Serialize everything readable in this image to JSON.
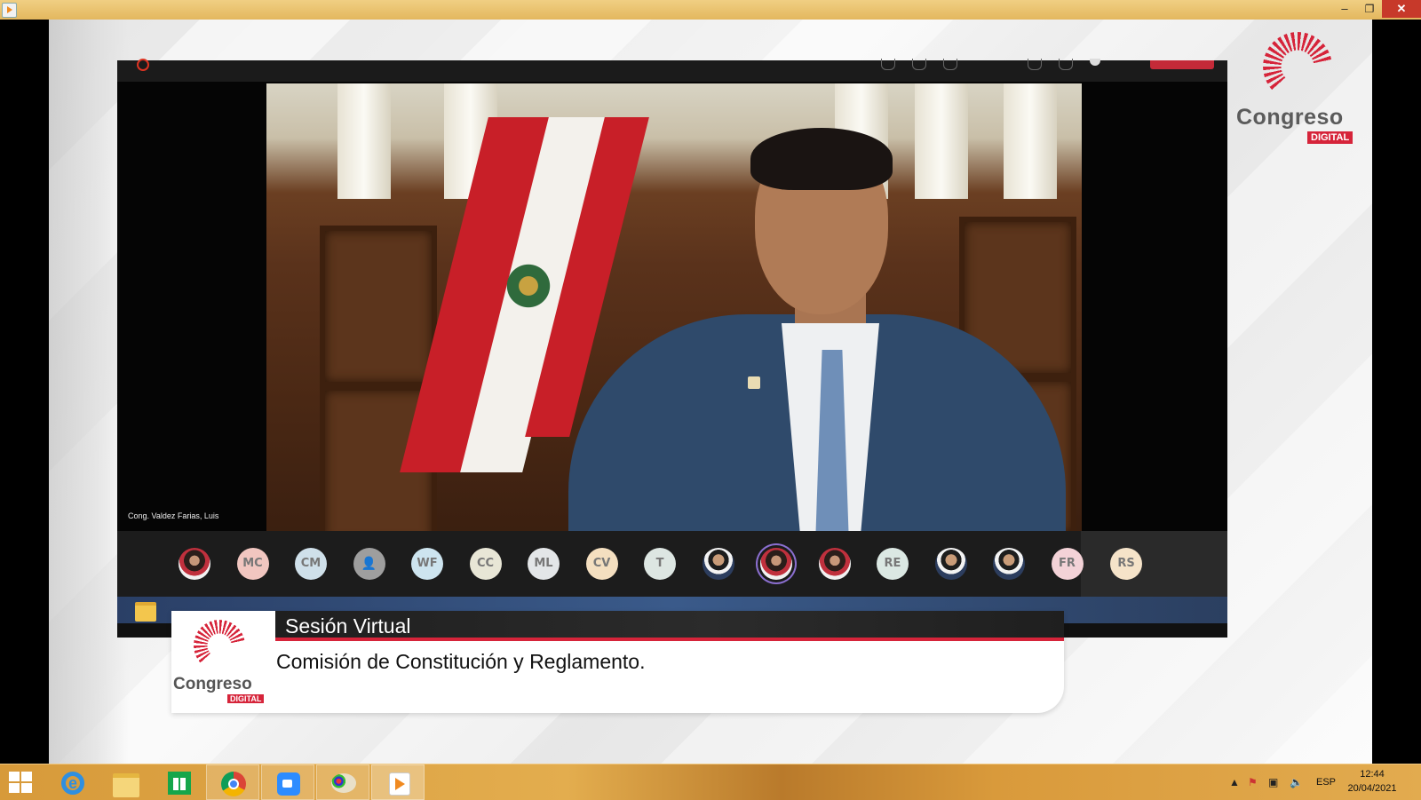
{
  "window": {
    "minimize_glyph": "–",
    "maximize_glyph": "❐",
    "close_glyph": "✕"
  },
  "brand": {
    "logo_word": "Congreso",
    "logo_badge": "DIGITAL",
    "accent_color": "#d6243a"
  },
  "meeting": {
    "speaker_name": "Cong. Valdez Farias, Luis",
    "participants": [
      {
        "initials": "",
        "kind": "photo-f",
        "color": ""
      },
      {
        "initials": "MC",
        "kind": "initials",
        "color": "#f1c6c0"
      },
      {
        "initials": "CM",
        "kind": "initials",
        "color": "#cfe0ea"
      },
      {
        "initials": "",
        "kind": "user",
        "color": "#9e9e9e"
      },
      {
        "initials": "WF",
        "kind": "initials",
        "color": "#cde4ef"
      },
      {
        "initials": "CC",
        "kind": "initials",
        "color": "#e8e6d6"
      },
      {
        "initials": "ML",
        "kind": "initials",
        "color": "#e3e6e8"
      },
      {
        "initials": "CV",
        "kind": "initials",
        "color": "#f4dfc0"
      },
      {
        "initials": "T",
        "kind": "initials",
        "color": "#dde6e2"
      },
      {
        "initials": "",
        "kind": "photo",
        "color": ""
      },
      {
        "initials": "",
        "kind": "photo-f",
        "color": "",
        "active": true
      },
      {
        "initials": "",
        "kind": "photo-f",
        "color": ""
      },
      {
        "initials": "RE",
        "kind": "initials",
        "color": "#dbe8e3"
      },
      {
        "initials": "",
        "kind": "photo",
        "color": ""
      },
      {
        "initials": "",
        "kind": "photo",
        "color": ""
      },
      {
        "initials": "FR",
        "kind": "initials",
        "color": "#f3d2d7"
      },
      {
        "initials": "RS",
        "kind": "initials",
        "color": "#f5e3c9"
      }
    ]
  },
  "lower_third": {
    "title": "Sesión Virtual",
    "subtitle": "Comisión de Constitución y Reglamento."
  },
  "taskbar": {
    "apps": [
      "start",
      "internet-explorer",
      "file-explorer",
      "store",
      "chrome",
      "zoom",
      "paint",
      "media-player"
    ],
    "running": [
      "chrome",
      "zoom",
      "paint",
      "media-player"
    ],
    "language": "ESP",
    "time": "12:44",
    "date": "20/04/2021"
  }
}
